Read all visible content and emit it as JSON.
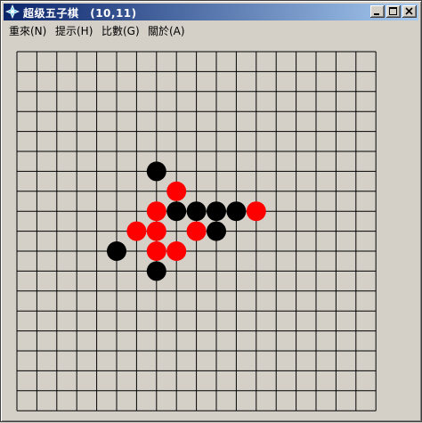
{
  "window": {
    "title_app": "超级五子棋",
    "title_coord": "(10,11)",
    "icon": "gomoku-app-icon"
  },
  "controls": {
    "minimize": "minimize-icon",
    "maximize": "maximize-icon",
    "close": "close-icon"
  },
  "menu": {
    "items": [
      {
        "label": "重來(N)"
      },
      {
        "label": "提示(H)"
      },
      {
        "label": "比數(G)"
      },
      {
        "label": "關於(A)"
      }
    ]
  },
  "board": {
    "size": 19,
    "stones": [
      {
        "col": 7,
        "row": 6,
        "color": "black"
      },
      {
        "col": 8,
        "row": 7,
        "color": "red"
      },
      {
        "col": 7,
        "row": 8,
        "color": "red"
      },
      {
        "col": 8,
        "row": 8,
        "color": "black"
      },
      {
        "col": 9,
        "row": 8,
        "color": "black"
      },
      {
        "col": 10,
        "row": 8,
        "color": "black"
      },
      {
        "col": 11,
        "row": 8,
        "color": "black"
      },
      {
        "col": 12,
        "row": 8,
        "color": "red"
      },
      {
        "col": 6,
        "row": 9,
        "color": "red"
      },
      {
        "col": 7,
        "row": 9,
        "color": "red"
      },
      {
        "col": 9,
        "row": 9,
        "color": "red"
      },
      {
        "col": 10,
        "row": 9,
        "color": "black"
      },
      {
        "col": 5,
        "row": 10,
        "color": "black"
      },
      {
        "col": 7,
        "row": 10,
        "color": "red"
      },
      {
        "col": 8,
        "row": 10,
        "color": "red"
      },
      {
        "col": 7,
        "row": 11,
        "color": "black"
      }
    ]
  },
  "colors": {
    "black_stone": "#000000",
    "red_stone": "#ff0000",
    "grid": "#000000",
    "board_bg": "#d4d0c8",
    "titlebar_left": "#0a246a",
    "titlebar_right": "#a6caf0"
  }
}
